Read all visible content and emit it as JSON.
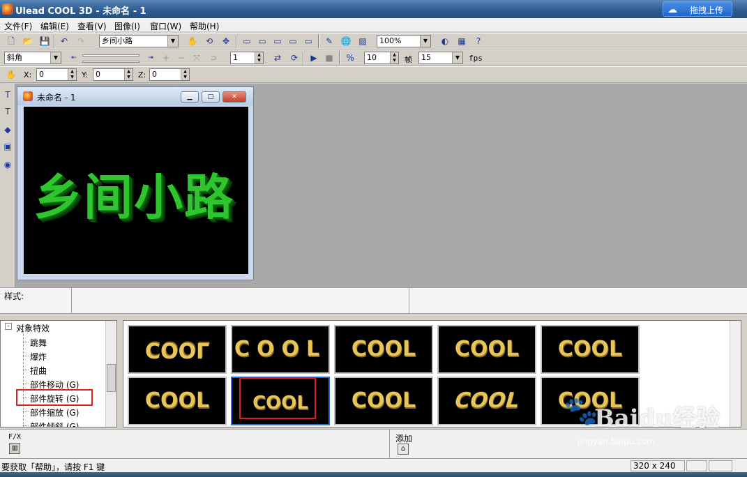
{
  "window": {
    "title": "Ulead COOL 3D - 未命名 - 1",
    "upload_label": "拖拽上传"
  },
  "menu": [
    "文件(F)",
    "编辑(E)",
    "查看(V)",
    "图像(I)",
    "窗口(W)",
    "帮助(H)"
  ],
  "toolbar1": {
    "text_object_value": "乡间小路",
    "zoom_value": "100%"
  },
  "toolbar2": {
    "bevel_value": "斜角",
    "frame_value": "1",
    "frames_count": "10",
    "frames_label": "帧",
    "fps_value": "15",
    "fps_label": "fps"
  },
  "toolbar3": {
    "x_label": "X:",
    "x_value": "0",
    "y_label": "Y:",
    "y_value": "0",
    "z_label": "Z:",
    "z_value": "0"
  },
  "document": {
    "title": "未命名 - 1",
    "canvas_text": "乡间小路",
    "text_color": "#2ec52e"
  },
  "style_panel": {
    "label": "样式:"
  },
  "effects_tree": {
    "root": "对象特效",
    "root_toggle": "-",
    "items": [
      "跳舞",
      "爆炸",
      "扭曲",
      "部件移动 (G)",
      "部件旋转 (G)",
      "部件缩放 (G)",
      "部件倾斜 (G)"
    ],
    "selected_index": 4
  },
  "gallery": {
    "thumbnails": [
      "COOL",
      "COOL",
      "COOL",
      "COOL",
      "COOL",
      "COOL",
      "COOL",
      "COOL",
      "COOL",
      "COOL"
    ],
    "selected_index": 6,
    "thumb_color": "#e8c558"
  },
  "bottom_panel": {
    "fx_label": "F/X",
    "add_label": "添加"
  },
  "status": {
    "message": "要获取「帮助」，请按 F1 键",
    "size": "320 x 240"
  },
  "watermark": {
    "brand": "Baidu经验",
    "site": "jingyan.baidu.com"
  }
}
